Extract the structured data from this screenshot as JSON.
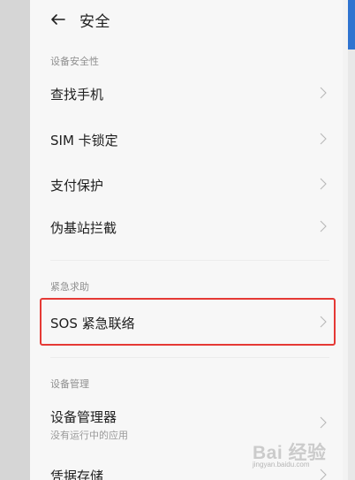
{
  "header": {
    "back_icon": "arrow-left-icon",
    "title": "安全"
  },
  "sections": [
    {
      "label": "设备安全性",
      "items": [
        {
          "label": "查找手机"
        },
        {
          "label": "SIM 卡锁定"
        },
        {
          "label": "支付保护"
        },
        {
          "label": "伪基站拦截"
        }
      ]
    },
    {
      "label": "紧急求助",
      "items": [
        {
          "label": "SOS 紧急联络"
        }
      ]
    },
    {
      "label": "设备管理",
      "items": [
        {
          "label": "设备管理器",
          "subtitle": "没有运行中的应用"
        },
        {
          "label": "凭据存储"
        }
      ]
    }
  ],
  "watermark": {
    "main": "Bai 经验",
    "sub": "jingyan.baidu.com"
  },
  "colors": {
    "highlight": "#e53935",
    "accent_blue": "#2f74d0"
  }
}
